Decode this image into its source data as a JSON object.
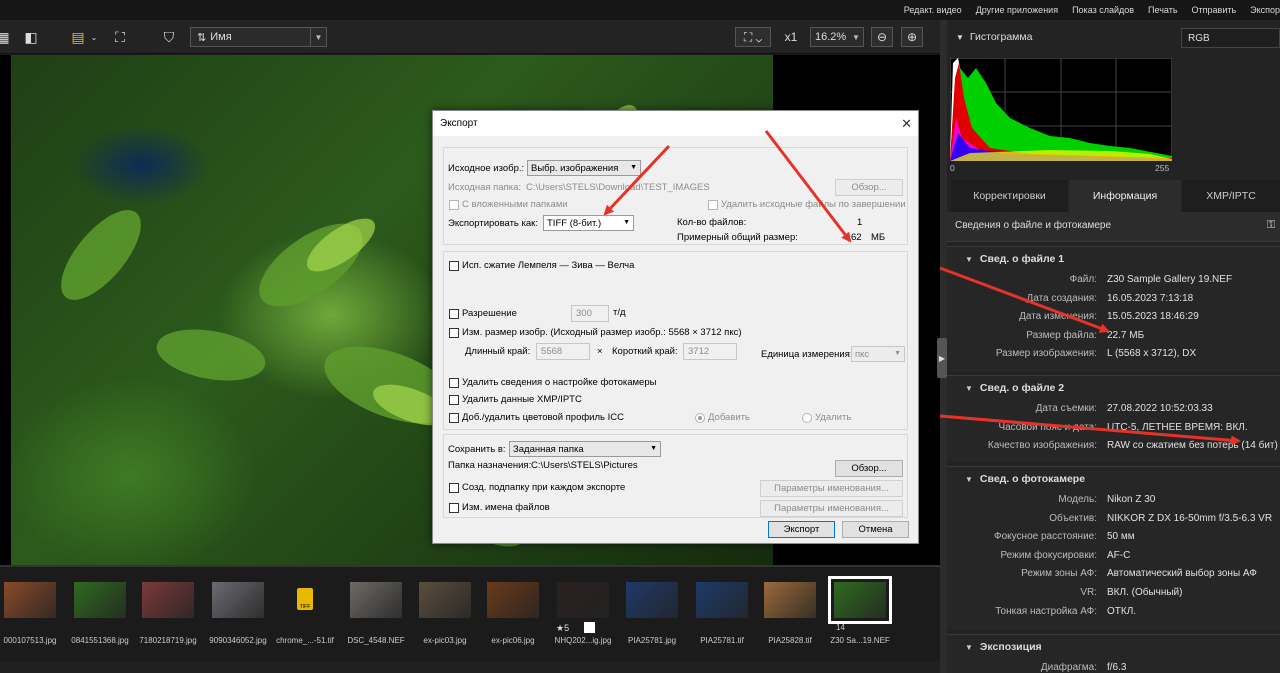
{
  "top_menu": [
    "Редакт. видео",
    "Другие приложения",
    "Показ слайдов",
    "Печать",
    "Отправить",
    "Экспорт"
  ],
  "toolbar": {
    "sort_label": "Имя",
    "zoom_x": "x1",
    "zoom_percent": "16.2%"
  },
  "dialog": {
    "title": "Экспорт",
    "source_label": "Исходное изобр.:",
    "source_value": "Выбр. изображения",
    "source_folder_label": "Исходная папка:",
    "source_folder_value": "C:\\Users\\STELS\\Download\\TEST_IMAGES",
    "browse_label": "Обзор...",
    "subfolders_label": "С вложенными папками",
    "delete_source_label": "Удалить исходные файлы по завершении",
    "export_as_label": "Экспортировать как:",
    "export_as_value": "TIFF (8-бит.)",
    "file_count_label": "Кол-во файлов:",
    "file_count_value": "1",
    "total_size_label": "Примерный общий размер:",
    "total_size_value": "62",
    "total_size_unit": "МБ",
    "lzw_label": "Исп. сжатие Лемпеля — Зива — Велча",
    "resolution_label": "Разрешение",
    "resolution_value": "300",
    "resolution_unit": "т/д",
    "resize_label": "Изм. размер изобр. (Исходный размер изобр.: 5568 × 3712 пкс)",
    "long_edge_label": "Длинный край:",
    "long_edge_value": "5568",
    "times": "×",
    "short_edge_label": "Короткий край:",
    "short_edge_value": "3712",
    "unit_label": "Единица измерения:",
    "unit_value": "пкс",
    "remove_camera_label": "Удалить сведения о настройке фотокамеры",
    "remove_xmp_label": "Удалить данные XMP/IPTC",
    "icc_label": "Доб./удалить цветовой профиль ICC",
    "add_label": "Добавить",
    "remove_label": "Удалить",
    "save_in_label": "Сохранить в:",
    "save_in_value": "Заданная папка",
    "dest_folder_label": "Папка назначения:",
    "dest_folder_value": "C:\\Users\\STELS\\Pictures",
    "browse2_label": "Обзор...",
    "subfolder_each_label": "Созд. подпапку при каждом экспорте",
    "naming_params_label": "Параметры именования...",
    "rename_label": "Изм. имена файлов",
    "naming_params2_label": "Параметры именования...",
    "export_button": "Экспорт",
    "cancel_button": "Отмена"
  },
  "filmstrip": [
    {
      "label": "000107513.jpg",
      "color": "#8a4a2a"
    },
    {
      "label": "0841551368.jpg",
      "color": "#2f6a1f"
    },
    {
      "label": "7180218719.jpg",
      "color": "#7a3a3a"
    },
    {
      "label": "9090346052.jpg",
      "color": "#6a6a72"
    },
    {
      "label": "chrome_...-51.tif",
      "color": "#1b1b1b"
    },
    {
      "label": "DSC_4548.NEF",
      "color": "#6e6a66"
    },
    {
      "label": "ex-pic03.jpg",
      "color": "#5a4e3e"
    },
    {
      "label": "ex-pic06.jpg",
      "color": "#6a3a1a"
    },
    {
      "label": "NHQ202...ig.jpg",
      "color": "#2a2020"
    },
    {
      "label": "PIA25781.jpg",
      "color": "#1e3a6a"
    },
    {
      "label": "PIA25781.tif",
      "color": "#1e3a6a"
    },
    {
      "label": "PIA25828.tif",
      "color": "#9a6a3a"
    },
    {
      "label": "Z30 Sa...19.NEF",
      "color": "#2f6a1f"
    }
  ],
  "filmstrip_badges": {
    "rating": "★5",
    "thumb_num": "14",
    "tiff_icon_text": "TIFF"
  },
  "right_panel": {
    "histogram_title": "Гистограмма",
    "histogram_mode": "RGB",
    "hist_min": "0",
    "hist_max": "255",
    "tabs": [
      "Корректировки",
      "Информация",
      "XMP/IPTC"
    ],
    "active_tab": 1,
    "info_header": "Сведения о файле и фотокамере",
    "sections": [
      {
        "title": "Свед. о файле 1",
        "rows": [
          {
            "k": "Файл:",
            "v": "Z30 Sample Gallery 19.NEF"
          },
          {
            "k": "Дата создания:",
            "v": "16.05.2023 7:13:18"
          },
          {
            "k": "Дата изменения:",
            "v": "15.05.2023 18:46:29"
          },
          {
            "k": "Размер файла:",
            "v": "22.7 МБ"
          },
          {
            "k": "Размер изображения:",
            "v": "L (5568 x 3712), DX"
          }
        ]
      },
      {
        "title": "Свед. о файле 2",
        "rows": [
          {
            "k": "Дата съемки:",
            "v": "27.08.2022 10:52:03.33"
          },
          {
            "k": "Часовой пояс и дата:",
            "v": "UTC-5, ЛЕТНЕЕ ВРЕМЯ: ВКЛ."
          },
          {
            "k": "Качество изображения:",
            "v": "RAW со сжатием без потерь (14 бит)"
          }
        ]
      },
      {
        "title": "Свед. о фотокамере",
        "rows": [
          {
            "k": "Модель:",
            "v": "Nikon Z 30"
          },
          {
            "k": "Объектив:",
            "v": "NIKKOR Z DX 16-50mm f/3.5-6.3 VR"
          },
          {
            "k": "Фокусное расстояние:",
            "v": "50 мм"
          },
          {
            "k": "Режим фокусировки:",
            "v": "AF-C"
          },
          {
            "k": "Режим зоны АФ:",
            "v": "Автоматический выбор зоны АФ"
          },
          {
            "k": "VR:",
            "v": "ВКЛ. (Обычный)"
          },
          {
            "k": "Тонкая настройка АФ:",
            "v": "ОТКЛ."
          }
        ]
      },
      {
        "title": "Экспозиция",
        "rows": [
          {
            "k": "Диафрагма:",
            "v": "f/6.3"
          }
        ]
      }
    ]
  },
  "colors": {
    "arrow": "#e5332a",
    "accent": "#ffffff"
  }
}
